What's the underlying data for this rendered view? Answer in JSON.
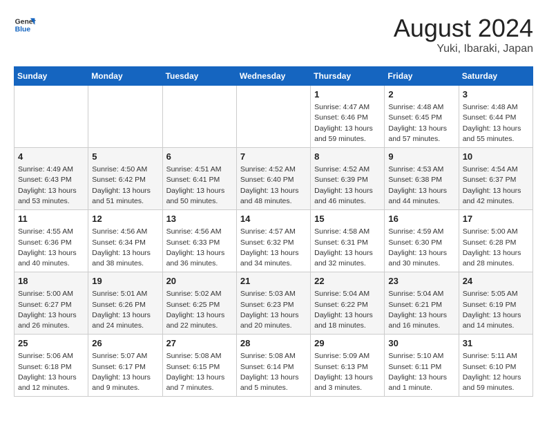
{
  "logo": {
    "general": "General",
    "blue": "Blue"
  },
  "title": "August 2024",
  "subtitle": "Yuki, Ibaraki, Japan",
  "headers": [
    "Sunday",
    "Monday",
    "Tuesday",
    "Wednesday",
    "Thursday",
    "Friday",
    "Saturday"
  ],
  "weeks": [
    [
      {
        "day": "",
        "info": ""
      },
      {
        "day": "",
        "info": ""
      },
      {
        "day": "",
        "info": ""
      },
      {
        "day": "",
        "info": ""
      },
      {
        "day": "1",
        "info": "Sunrise: 4:47 AM\nSunset: 6:46 PM\nDaylight: 13 hours\nand 59 minutes."
      },
      {
        "day": "2",
        "info": "Sunrise: 4:48 AM\nSunset: 6:45 PM\nDaylight: 13 hours\nand 57 minutes."
      },
      {
        "day": "3",
        "info": "Sunrise: 4:48 AM\nSunset: 6:44 PM\nDaylight: 13 hours\nand 55 minutes."
      }
    ],
    [
      {
        "day": "4",
        "info": "Sunrise: 4:49 AM\nSunset: 6:43 PM\nDaylight: 13 hours\nand 53 minutes."
      },
      {
        "day": "5",
        "info": "Sunrise: 4:50 AM\nSunset: 6:42 PM\nDaylight: 13 hours\nand 51 minutes."
      },
      {
        "day": "6",
        "info": "Sunrise: 4:51 AM\nSunset: 6:41 PM\nDaylight: 13 hours\nand 50 minutes."
      },
      {
        "day": "7",
        "info": "Sunrise: 4:52 AM\nSunset: 6:40 PM\nDaylight: 13 hours\nand 48 minutes."
      },
      {
        "day": "8",
        "info": "Sunrise: 4:52 AM\nSunset: 6:39 PM\nDaylight: 13 hours\nand 46 minutes."
      },
      {
        "day": "9",
        "info": "Sunrise: 4:53 AM\nSunset: 6:38 PM\nDaylight: 13 hours\nand 44 minutes."
      },
      {
        "day": "10",
        "info": "Sunrise: 4:54 AM\nSunset: 6:37 PM\nDaylight: 13 hours\nand 42 minutes."
      }
    ],
    [
      {
        "day": "11",
        "info": "Sunrise: 4:55 AM\nSunset: 6:36 PM\nDaylight: 13 hours\nand 40 minutes."
      },
      {
        "day": "12",
        "info": "Sunrise: 4:56 AM\nSunset: 6:34 PM\nDaylight: 13 hours\nand 38 minutes."
      },
      {
        "day": "13",
        "info": "Sunrise: 4:56 AM\nSunset: 6:33 PM\nDaylight: 13 hours\nand 36 minutes."
      },
      {
        "day": "14",
        "info": "Sunrise: 4:57 AM\nSunset: 6:32 PM\nDaylight: 13 hours\nand 34 minutes."
      },
      {
        "day": "15",
        "info": "Sunrise: 4:58 AM\nSunset: 6:31 PM\nDaylight: 13 hours\nand 32 minutes."
      },
      {
        "day": "16",
        "info": "Sunrise: 4:59 AM\nSunset: 6:30 PM\nDaylight: 13 hours\nand 30 minutes."
      },
      {
        "day": "17",
        "info": "Sunrise: 5:00 AM\nSunset: 6:28 PM\nDaylight: 13 hours\nand 28 minutes."
      }
    ],
    [
      {
        "day": "18",
        "info": "Sunrise: 5:00 AM\nSunset: 6:27 PM\nDaylight: 13 hours\nand 26 minutes."
      },
      {
        "day": "19",
        "info": "Sunrise: 5:01 AM\nSunset: 6:26 PM\nDaylight: 13 hours\nand 24 minutes."
      },
      {
        "day": "20",
        "info": "Sunrise: 5:02 AM\nSunset: 6:25 PM\nDaylight: 13 hours\nand 22 minutes."
      },
      {
        "day": "21",
        "info": "Sunrise: 5:03 AM\nSunset: 6:23 PM\nDaylight: 13 hours\nand 20 minutes."
      },
      {
        "day": "22",
        "info": "Sunrise: 5:04 AM\nSunset: 6:22 PM\nDaylight: 13 hours\nand 18 minutes."
      },
      {
        "day": "23",
        "info": "Sunrise: 5:04 AM\nSunset: 6:21 PM\nDaylight: 13 hours\nand 16 minutes."
      },
      {
        "day": "24",
        "info": "Sunrise: 5:05 AM\nSunset: 6:19 PM\nDaylight: 13 hours\nand 14 minutes."
      }
    ],
    [
      {
        "day": "25",
        "info": "Sunrise: 5:06 AM\nSunset: 6:18 PM\nDaylight: 13 hours\nand 12 minutes."
      },
      {
        "day": "26",
        "info": "Sunrise: 5:07 AM\nSunset: 6:17 PM\nDaylight: 13 hours\nand 9 minutes."
      },
      {
        "day": "27",
        "info": "Sunrise: 5:08 AM\nSunset: 6:15 PM\nDaylight: 13 hours\nand 7 minutes."
      },
      {
        "day": "28",
        "info": "Sunrise: 5:08 AM\nSunset: 6:14 PM\nDaylight: 13 hours\nand 5 minutes."
      },
      {
        "day": "29",
        "info": "Sunrise: 5:09 AM\nSunset: 6:13 PM\nDaylight: 13 hours\nand 3 minutes."
      },
      {
        "day": "30",
        "info": "Sunrise: 5:10 AM\nSunset: 6:11 PM\nDaylight: 13 hours\nand 1 minute."
      },
      {
        "day": "31",
        "info": "Sunrise: 5:11 AM\nSunset: 6:10 PM\nDaylight: 12 hours\nand 59 minutes."
      }
    ]
  ]
}
